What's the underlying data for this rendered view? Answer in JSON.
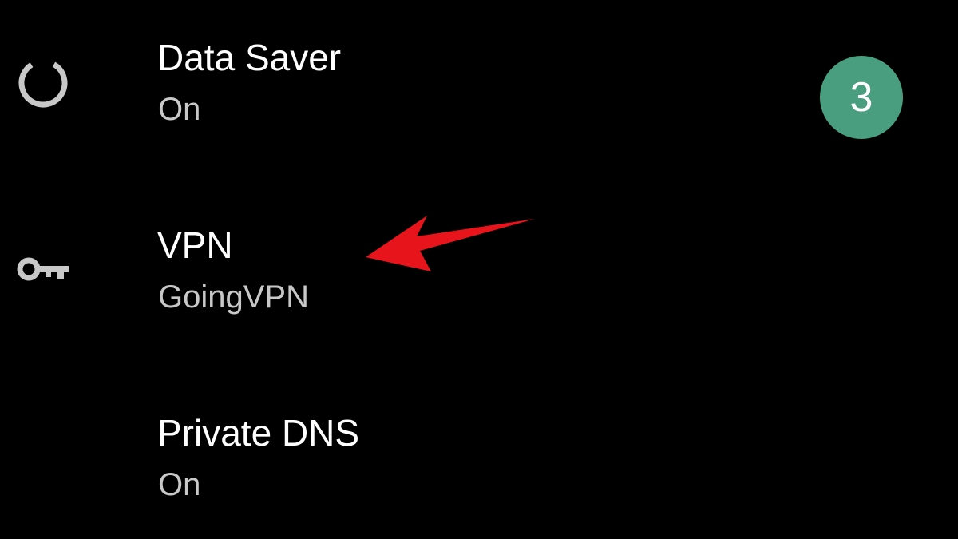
{
  "settings": {
    "items": [
      {
        "title": "Data Saver",
        "subtitle": "On",
        "icon": "data-saver-icon"
      },
      {
        "title": "VPN",
        "subtitle": "GoingVPN",
        "icon": "key-icon"
      },
      {
        "title": "Private DNS",
        "subtitle": "On",
        "icon": "none"
      }
    ]
  },
  "annotation": {
    "step_number": "3",
    "badge_color": "#4a9e80",
    "arrow_color": "#e8141c",
    "arrow_points_to": "VPN"
  },
  "theme": {
    "background": "#000000",
    "title_color": "#ffffff",
    "subtitle_color": "#c8c8c8",
    "icon_color": "#c8c8c8"
  }
}
